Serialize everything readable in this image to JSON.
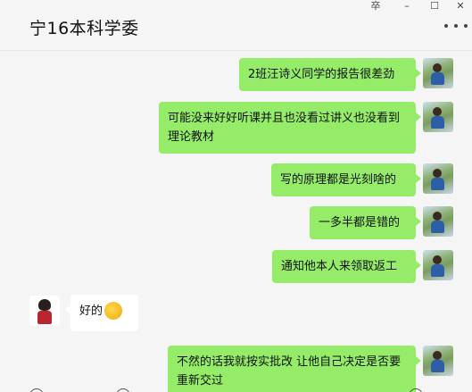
{
  "window": {
    "title": "宁16本科学委",
    "controls": [
      "卒",
      "–",
      "☐",
      "✕"
    ]
  },
  "messages": [
    {
      "side": "me",
      "text": "2班汪诗义同学的报告很差劲"
    },
    {
      "side": "me",
      "text": "可能没来好好听课并且也没看过讲义也没看到理论教材"
    },
    {
      "side": "me",
      "text": "写的原理都是光刻啥的"
    },
    {
      "side": "me",
      "text": "一多半都是错的"
    },
    {
      "side": "me",
      "text": "通知他本人来领取返工"
    },
    {
      "side": "other",
      "text": "好的",
      "emoji": "facepalm-emoji"
    },
    {
      "side": "me",
      "text": "不然的话我就按实批改 让他自己决定是否要重新交过"
    }
  ],
  "colors": {
    "my_bubble": "#95ec69",
    "other_bubble": "#ffffff",
    "background": "#f5f5f5"
  },
  "icons": {
    "more": "more-options-icon",
    "emoji": "emoji-icon",
    "scissors": "scissors-icon"
  }
}
